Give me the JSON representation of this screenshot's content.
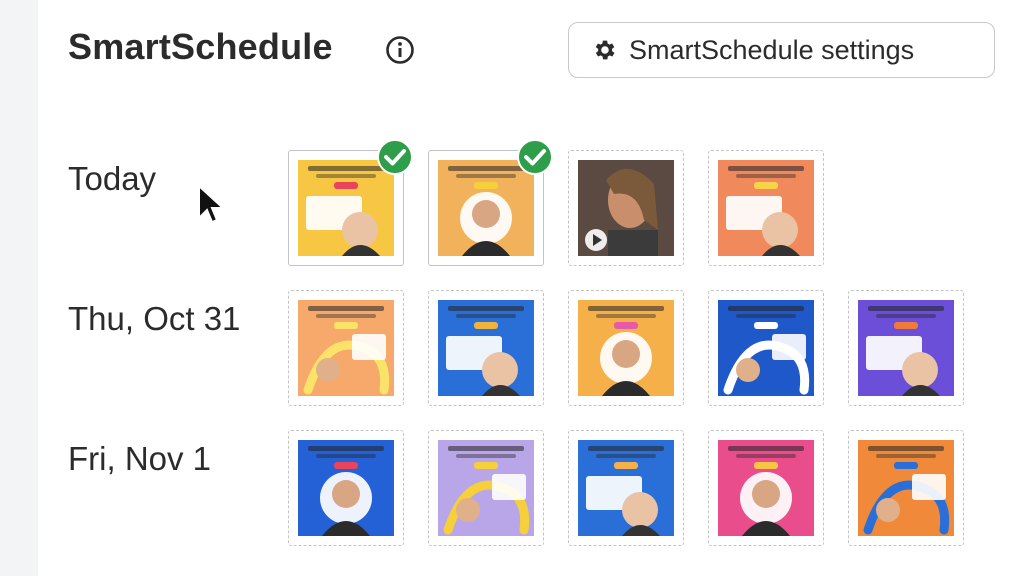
{
  "header": {
    "title": "SmartSchedule",
    "settings_label": "SmartSchedule settings"
  },
  "days": [
    {
      "label": "Today",
      "posts": [
        {
          "bg": "#f7c744",
          "accent": "#e8445a",
          "status": "posted"
        },
        {
          "bg": "#f2b25c",
          "accent": "#f5d03a",
          "status": "posted"
        },
        {
          "bg": "#5a4a42",
          "accent": "#c98e6c",
          "status": "video"
        },
        {
          "bg": "#f08a5d",
          "accent": "#f9d34a",
          "status": "scheduled"
        }
      ]
    },
    {
      "label": "Thu, Oct 31",
      "posts": [
        {
          "bg": "#f6a96b",
          "accent": "#fbe36a",
          "status": "scheduled"
        },
        {
          "bg": "#2a6fd8",
          "accent": "#f2b33c",
          "status": "scheduled"
        },
        {
          "bg": "#f5b04a",
          "accent": "#e65aa8",
          "status": "scheduled"
        },
        {
          "bg": "#1f58c9",
          "accent": "#ffffff",
          "status": "scheduled"
        },
        {
          "bg": "#6b4fd8",
          "accent": "#f07a3a",
          "status": "scheduled"
        }
      ]
    },
    {
      "label": "Fri, Nov 1",
      "posts": [
        {
          "bg": "#2561d6",
          "accent": "#e8445a",
          "status": "scheduled"
        },
        {
          "bg": "#b9a6e8",
          "accent": "#f5d03a",
          "status": "scheduled"
        },
        {
          "bg": "#2a6fd8",
          "accent": "#f5b04a",
          "status": "scheduled"
        },
        {
          "bg": "#e94d8c",
          "accent": "#f7c744",
          "status": "scheduled"
        },
        {
          "bg": "#f08a3a",
          "accent": "#2a6fd8",
          "status": "scheduled"
        }
      ]
    }
  ],
  "colors": {
    "check_green": "#2e9e4a",
    "border": "#c4c4c4"
  }
}
